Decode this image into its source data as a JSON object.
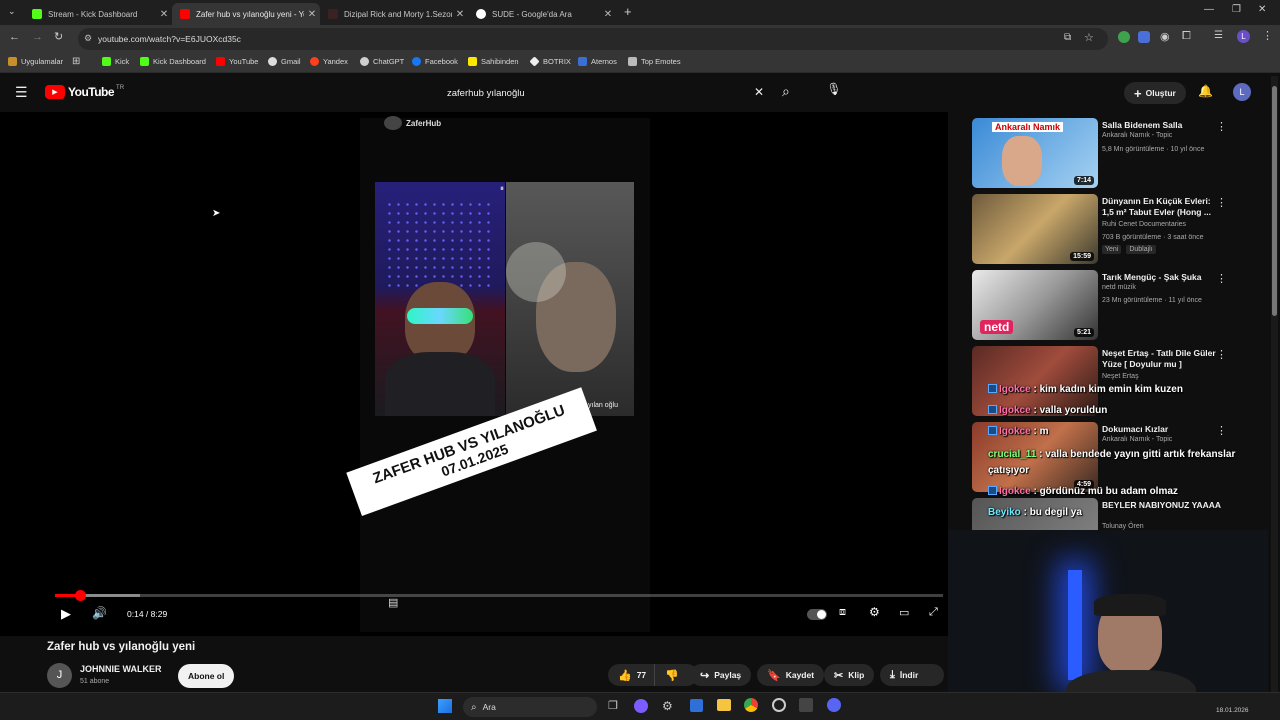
{
  "browser": {
    "tabs": [
      {
        "title": "Stream - Kick Dashboard",
        "color": "#53fc18"
      },
      {
        "title": "Zafer hub vs yılanoğlu yeni - Yo",
        "color": "#ff0000"
      },
      {
        "title": "Dizipal Rick and Morty 1.Sezon",
        "color": "#2d2d2d"
      },
      {
        "title": "SUDE - Google'da Ara",
        "color": "#ffffff"
      }
    ],
    "url": "youtube.com/watch?v=E6JUOXcd35c",
    "bookmarks": [
      "Uygulamalar",
      "Kick",
      "Kick Dashboard",
      "YouTube",
      "Gmail",
      "Yandex",
      "ChatGPT",
      "Facebook",
      "Sahibinden",
      "BOTRIX",
      "Aternos",
      "Top Emotes"
    ],
    "profile_letter": "L"
  },
  "youtube": {
    "logo_text": "YouTube",
    "logo_region": "TR",
    "search_value": "zaferhub yılanoğlu",
    "create_label": "Oluştur",
    "avatar_letter": "L"
  },
  "video": {
    "channel_tag": "ZaferHub",
    "overlay_name": "yılan oğlu",
    "banner_line1": "ZAFER HUB VS YILANOĞLU",
    "banner_line2": "07.01.2025",
    "time": "0:14 / 8:29",
    "progress_fraction": 0.028,
    "title": "Zafer hub vs yılanoğlu yeni",
    "channel": "JOHNNIE WALKER",
    "channel_initial": "J",
    "subscribers": "51 abone",
    "subscribe_label": "Abone ol",
    "likes": "77",
    "share_label": "Paylaş",
    "save_label": "Kaydet",
    "clip_label": "Klip",
    "download_label": "İndir"
  },
  "recommendations": [
    {
      "title": "Salla Bidenem Salla",
      "channel": "Ankaralı Namık - Topic",
      "meta": "5,8 Mn görüntüleme · 10 yıl önce",
      "duration": "7:14",
      "thumb_text": "Ankaralı Namık"
    },
    {
      "title": "Dünyanın En Küçük Evleri: 1,5 m² Tabut Evler (Hong ...",
      "channel": "Ruhi Cenet Documentaries",
      "meta": "703 B görüntüleme · 3 saat önce",
      "duration": "15:59",
      "badge_new": "Yeni",
      "badge_dub": "Dublajlı"
    },
    {
      "title": "Tarık Mengüç - Şak Şuka",
      "channel": "netd müzik",
      "meta": "23 Mn görüntüleme · 11 yıl önce",
      "duration": "5:21",
      "thumb_text": "netd"
    },
    {
      "title": "Neşet Ertaş - Tatlı Dile Güler Yüze [ Doyulur mu ]",
      "channel": "Neşet Ertaş",
      "meta": "",
      "duration": ""
    },
    {
      "title": "Dokumacı Kızlar",
      "channel": "Ankaralı Namık - Topic",
      "meta": "",
      "duration": "4:59"
    },
    {
      "title": "BEYLER NABIYONUZ YAAAA",
      "channel": "Tolunay Ören",
      "meta": "",
      "duration": ""
    }
  ],
  "chat_overlay": [
    {
      "user": "Igokce",
      "msg": "kim kadın kim emin kim kuzen"
    },
    {
      "user": "Igokce",
      "msg": "valla yoruldun"
    },
    {
      "user": "Igokce",
      "msg": "m"
    },
    {
      "user": "crucial_11",
      "msg": "valla bendede yayın gitti artık frekanslar çatışıyor"
    },
    {
      "user": "Igokce",
      "msg": "gördünüz mü bu adam olmaz"
    },
    {
      "user": "Beyiko",
      "msg": "bu degil ya"
    }
  ],
  "taskbar": {
    "search_label": "Ara",
    "date": "18.01.2026"
  }
}
